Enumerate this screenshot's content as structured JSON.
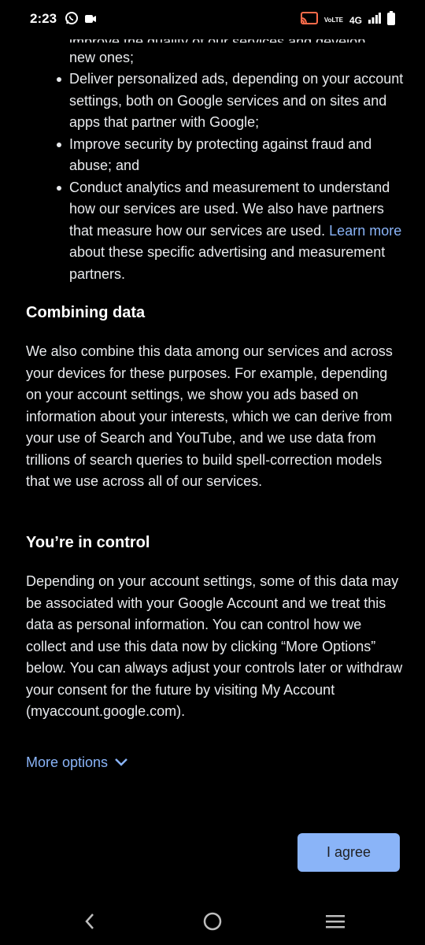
{
  "status_bar": {
    "time": "2:23",
    "network": "4G",
    "volte": "VoLTE"
  },
  "policy": {
    "cut_line": "improve the quality of our services and develop",
    "continuation": "new ones;",
    "bullets": [
      {
        "text": "Deliver personalized ads, depending on your account settings, both on Google services and on sites and apps that partner with Google;"
      },
      {
        "text": "Improve security by protecting against fraud and abuse; and"
      },
      {
        "text_before": "Conduct analytics and measurement to understand how our services are used. We also have partners that measure how our services are used. ",
        "link": "Learn more",
        "text_after": " about these specific advertising and measurement partners."
      }
    ],
    "combining_heading": "Combining data",
    "combining_body": "We also combine this data among our services and across your devices for these purposes. For example, depending on your account settings, we show you ads based on information about your interests, which we can derive from your use of Search and YouTube, and we use data from trillions of search queries to build spell-correction models that we use across all of our services.",
    "control_heading": "You’re in control",
    "control_body": "Depending on your account settings, some of this data may be associated with your Google Account and we treat this data as personal information. You can control how we collect and use this data now by clicking “More Options” below. You can always adjust your controls later or withdraw your consent for the future by visiting My Account (myaccount.google.com)."
  },
  "actions": {
    "more_options": "More options",
    "agree": "I agree"
  },
  "icons": {
    "whatsapp": "whatsapp-icon",
    "notification": "video-notification-icon",
    "cast": "cast-icon",
    "signal": "signal-icon",
    "battery": "battery-icon",
    "chevron": "chevron-down-icon",
    "back": "back-icon",
    "home": "home-icon",
    "recents": "recents-icon"
  },
  "colors": {
    "background": "#000000",
    "text": "#e8eaed",
    "link": "#8ab4f8",
    "button": "#8ab4f8"
  }
}
